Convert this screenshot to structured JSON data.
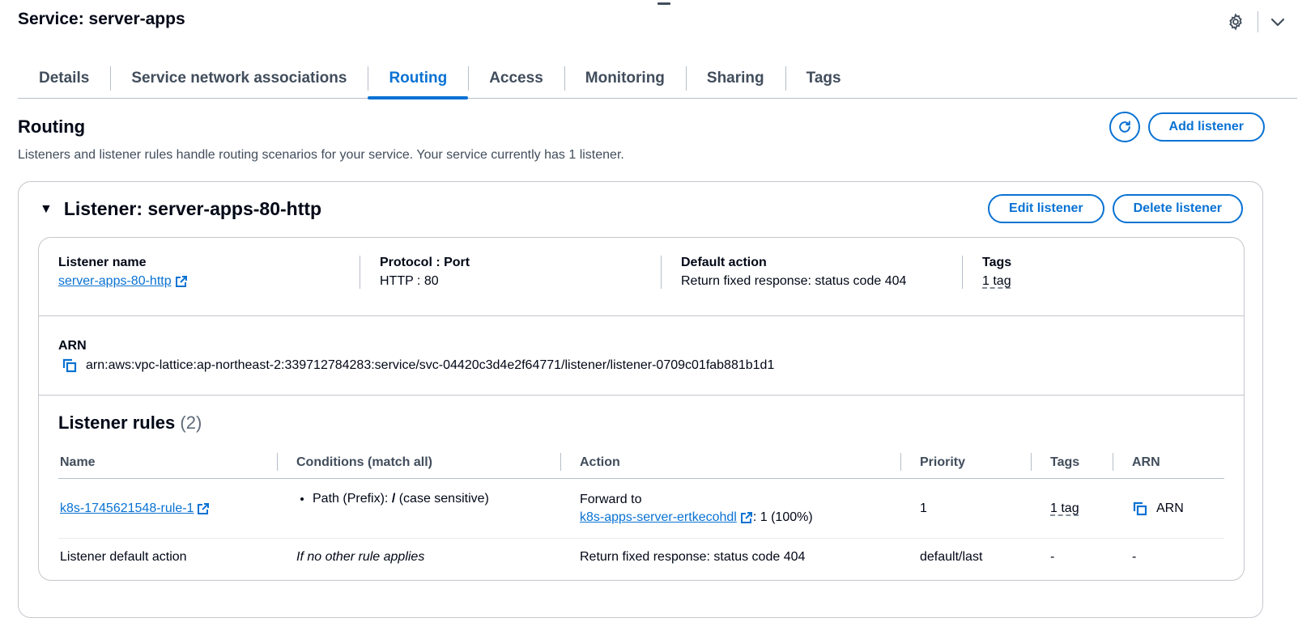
{
  "page": {
    "title": "Service: server-apps"
  },
  "tabs": [
    {
      "label": "Details"
    },
    {
      "label": "Service network associations"
    },
    {
      "label": "Routing"
    },
    {
      "label": "Access"
    },
    {
      "label": "Monitoring"
    },
    {
      "label": "Sharing"
    },
    {
      "label": "Tags"
    }
  ],
  "active_tab": "Routing",
  "routing": {
    "title": "Routing",
    "description": "Listeners and listener rules handle routing scenarios for your service. Your service currently has 1 listener.",
    "add_listener_label": "Add listener"
  },
  "listener": {
    "title": "Listener: server-apps-80-http",
    "edit_label": "Edit listener",
    "delete_label": "Delete listener",
    "details": {
      "name_label": "Listener name",
      "name_value": "server-apps-80-http",
      "protocol_label": "Protocol : Port",
      "protocol_value": "HTTP : 80",
      "default_action_label": "Default action",
      "default_action_value": "Return fixed response: status code 404",
      "tags_label": "Tags",
      "tags_value": "1 tag"
    },
    "arn_label": "ARN",
    "arn_value": "arn:aws:vpc-lattice:ap-northeast-2:339712784283:service/svc-04420c3d4e2f64771/listener/listener-0709c01fab881b1d1"
  },
  "rules": {
    "title": "Listener rules",
    "count": "(2)",
    "columns": {
      "name": "Name",
      "conditions": "Conditions (match all)",
      "action": "Action",
      "priority": "Priority",
      "tags": "Tags",
      "arn": "ARN"
    },
    "rows": [
      {
        "name": "k8s-1745621548-rule-1",
        "condition_prefix": "Path (Prefix): ",
        "condition_path": "/",
        "condition_suffix": " (case sensitive)",
        "action_line1": "Forward to",
        "action_target": "k8s-apps-server-ertkecohdl",
        "action_weight": ": 1 (100%)",
        "priority": "1",
        "tags": "1 tag",
        "arn": "ARN"
      },
      {
        "name": "Listener default action",
        "condition": "If no other rule applies",
        "action": "Return fixed response: status code 404",
        "priority": "default/last",
        "tags": "-",
        "arn": "-"
      }
    ]
  },
  "icons": {
    "settings": "gear-icon",
    "collapse": "chevron-down-icon",
    "refresh": "refresh-icon",
    "external": "external-link-icon",
    "copy": "copy-icon",
    "expand": "caret-down-icon"
  },
  "colors": {
    "accent": "#0972d3",
    "text": "#000716",
    "muted": "#414d5c",
    "border": "#b6bec9"
  }
}
